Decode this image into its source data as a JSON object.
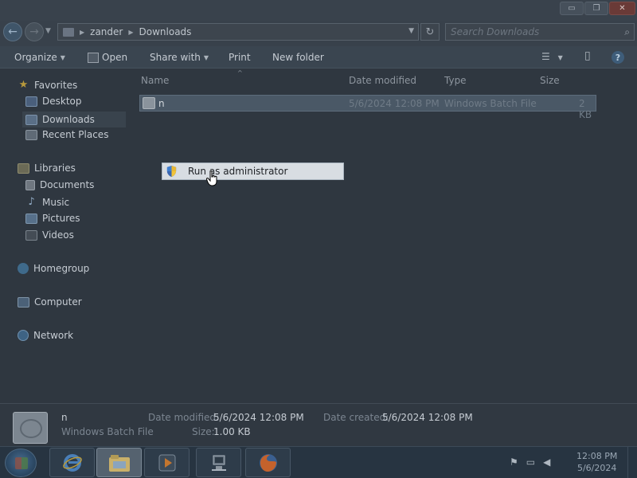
{
  "window": {
    "controls": {
      "minimize": "▭",
      "maximize": "❐",
      "close": "✕"
    }
  },
  "address_bar": {
    "back_glyph": "←",
    "forward_glyph": "→",
    "recent_glyph": "▼",
    "crumbs": [
      "zander",
      "Downloads"
    ],
    "separator": "▶",
    "dropdown_glyph": "▼",
    "refresh_glyph": "↻",
    "search_placeholder": "Search Downloads",
    "search_glyph": "⌕"
  },
  "toolbar": {
    "organize": "Organize",
    "open": "Open",
    "share_with": "Share with",
    "print": "Print",
    "new_folder": "New folder",
    "caret": "▼",
    "views_glyph": "☰",
    "preview_glyph": "▯",
    "help_glyph": "?"
  },
  "nav_pane": {
    "favorites": "Favorites",
    "desktop": "Desktop",
    "downloads": "Downloads",
    "recent_places": "Recent Places",
    "libraries": "Libraries",
    "documents": "Documents",
    "music": "Music",
    "pictures": "Pictures",
    "videos": "Videos",
    "homegroup": "Homegroup",
    "computer": "Computer",
    "network": "Network",
    "star_glyph": "★",
    "music_glyph": "♪"
  },
  "columns": {
    "name": "Name",
    "date_modified": "Date modified",
    "type": "Type",
    "size": "Size",
    "sort_glyph": "^"
  },
  "files": [
    {
      "name": "n",
      "date_modified": "5/6/2024 12:08 PM",
      "type": "Windows Batch File",
      "size": "2 KB"
    }
  ],
  "context_menu": {
    "run_as_admin": "Run as administrator"
  },
  "details_pane": {
    "name": "n",
    "type": "Windows Batch File",
    "date_modified_label": "Date modified:",
    "date_modified": "5/6/2024 12:08 PM",
    "date_created_label": "Date created:",
    "date_created": "5/6/2024 12:08 PM",
    "size_label": "Size:",
    "size": "1.00 KB"
  },
  "taskbar": {
    "tray_flag": "⚑",
    "tray_screen": "▭",
    "tray_volume": "◀",
    "time": "12:08 PM",
    "date": "5/6/2024"
  },
  "colors": {
    "background": "#2f3740",
    "context_menu_bg": "#d8dde2",
    "selected_row": "#4a5866",
    "taskbar": "#273441"
  }
}
